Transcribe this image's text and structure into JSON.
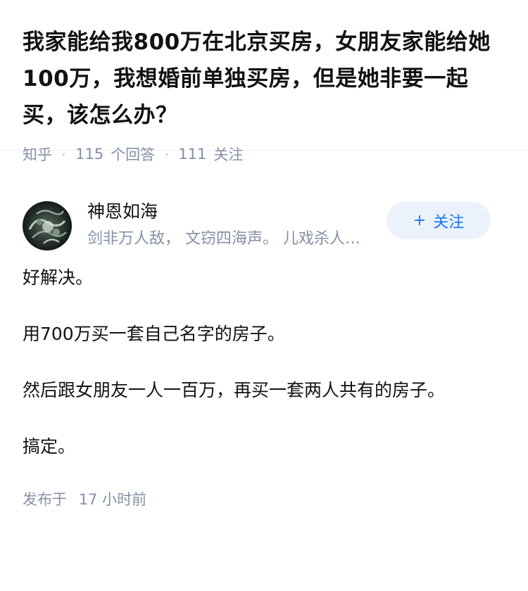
{
  "question": {
    "title": "我家能给我800万在北京买房，女朋友家能给她100万，我想婚前单独买房，但是她非要一起买，该怎么办？",
    "source": "知乎",
    "answers_count": "115",
    "answers_label": "个回答",
    "followers_count": "111",
    "followers_label": "关注"
  },
  "author": {
    "name": "神恩如海",
    "bio": "剑非万人敌， 文窃四海声。 儿戏杀人的 ...",
    "follow_label": "关注",
    "avatar_icon": "avatar-image"
  },
  "answer": {
    "paragraphs": [
      "好解决。",
      "用700万买一套自己名字的房子。",
      "然后跟女朋友一人一百万，再买一套两人共有的房子。",
      "搞定。"
    ],
    "posted_prefix": "发布于",
    "posted_time": "17 小时前"
  },
  "colors": {
    "accent": "#1772f6",
    "accent_bg": "#ebf2fc",
    "meta": "#8590a6",
    "text": "#121212"
  }
}
